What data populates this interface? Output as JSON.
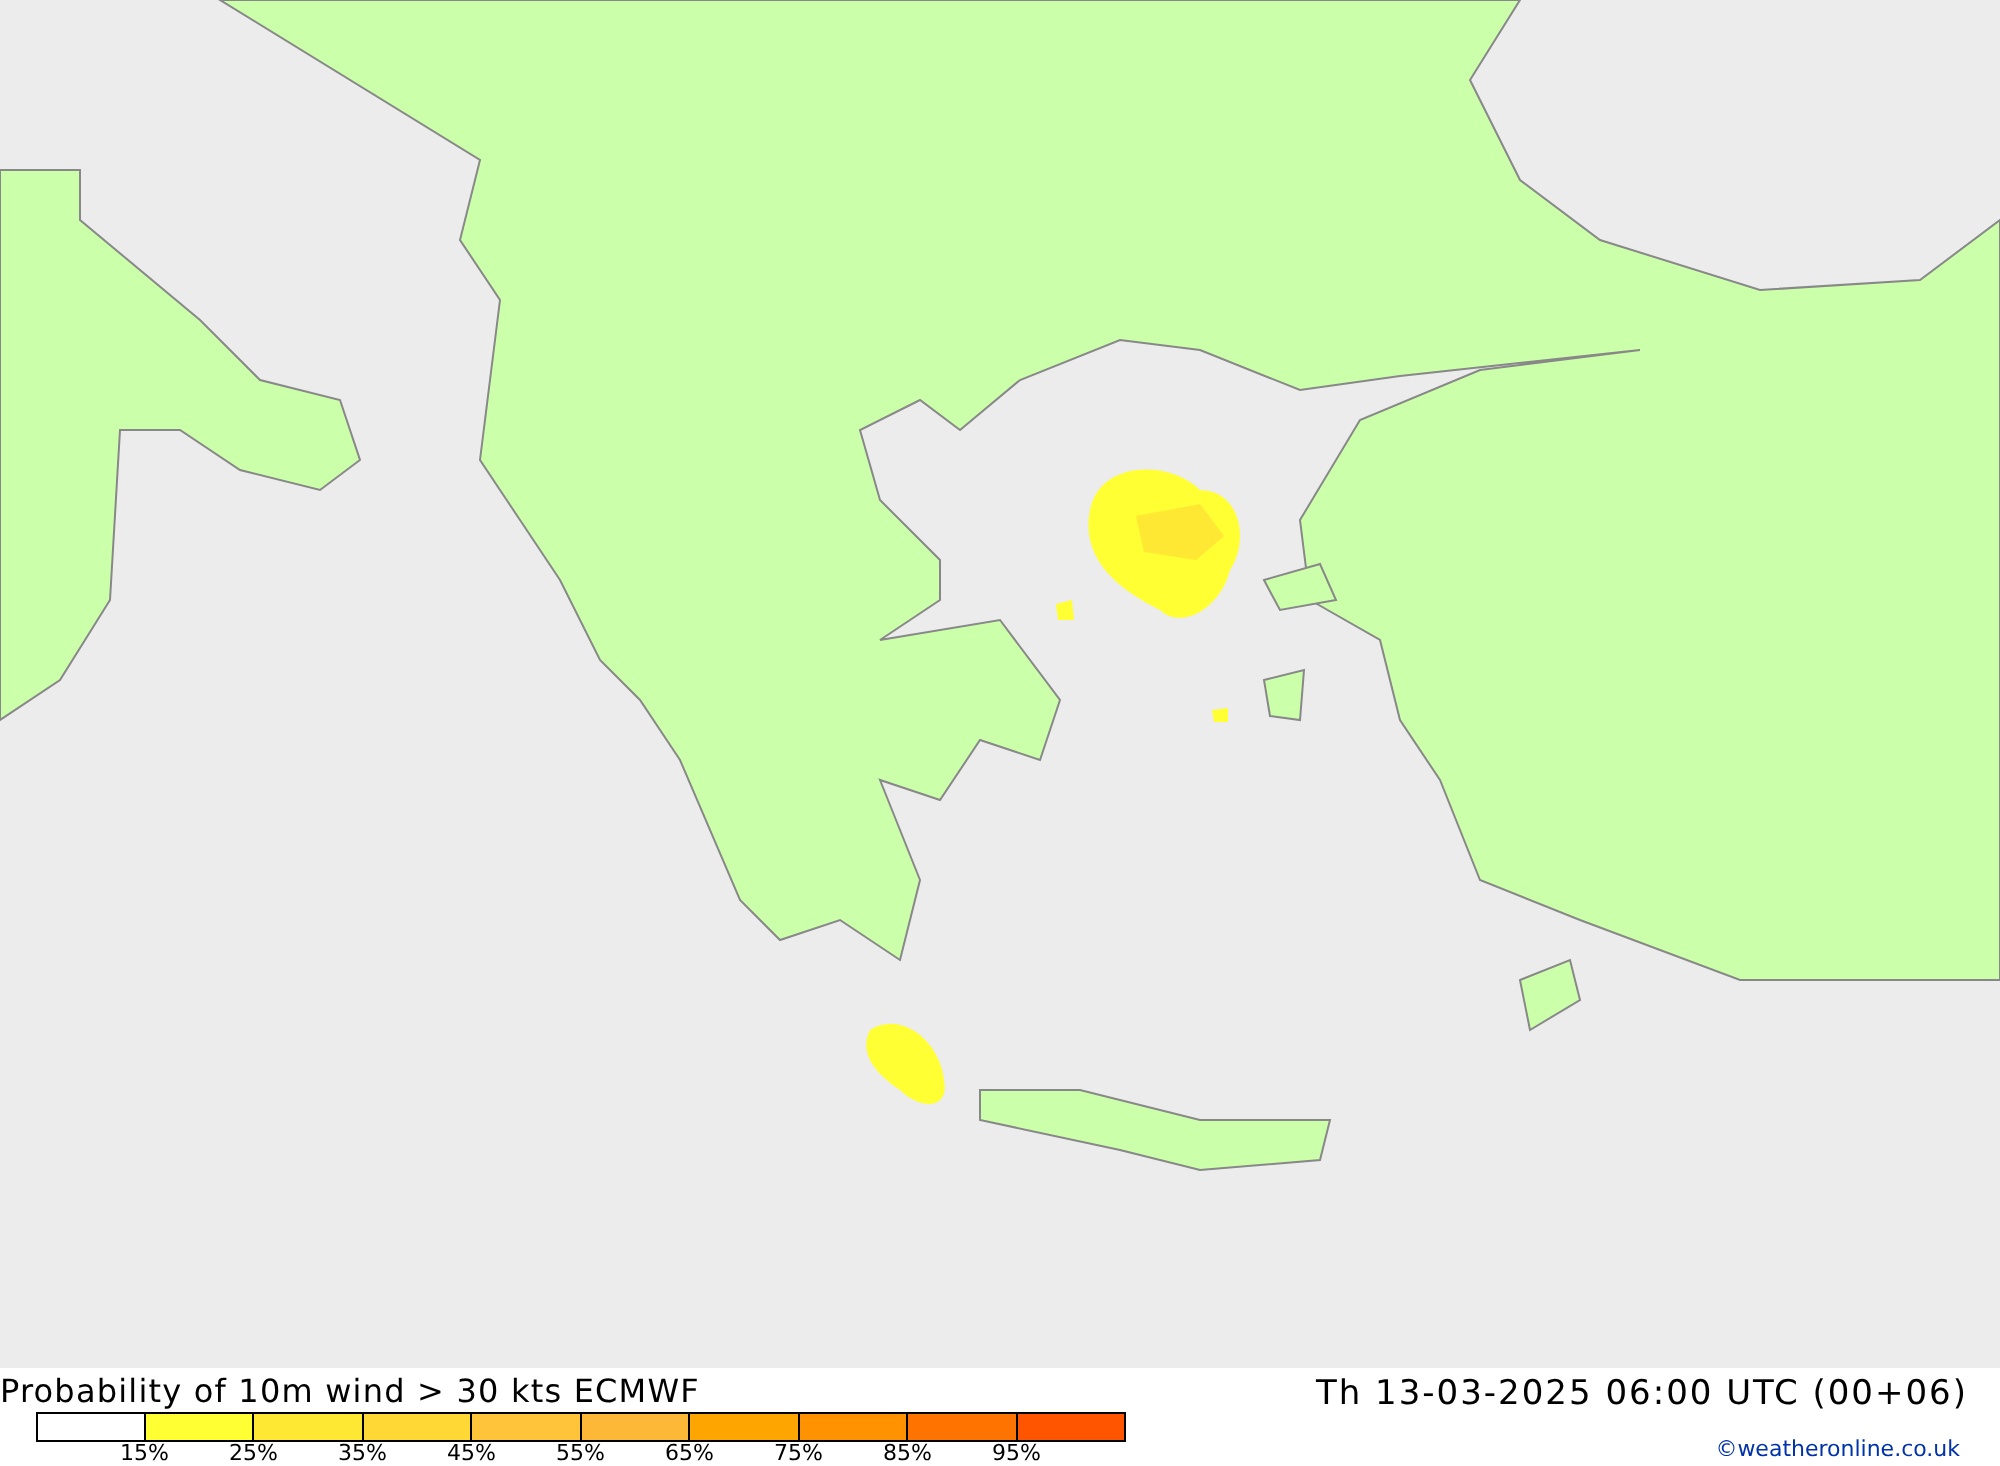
{
  "title": "Probability of 10m wind > 30 kts ECMWF",
  "valid_time": "Th 13-03-2025 06:00 UTC (00+06)",
  "legend": [
    {
      "color": "#ffffff"
    },
    {
      "color": "#ffff33",
      "label": "15%"
    },
    {
      "color": "#ffe833",
      "label": "25%"
    },
    {
      "color": "#ffd835",
      "label": "35%"
    },
    {
      "color": "#ffc43a",
      "label": "45%"
    },
    {
      "color": "#feb838",
      "label": "55%"
    },
    {
      "color": "#ffa500",
      "label": "65%"
    },
    {
      "color": "#ff9200",
      "label": "75%"
    },
    {
      "color": "#ff7400",
      "label": "85%"
    },
    {
      "color": "#ff5500",
      "label": "95%"
    }
  ],
  "credit": "©weatheronline.co.uk"
}
